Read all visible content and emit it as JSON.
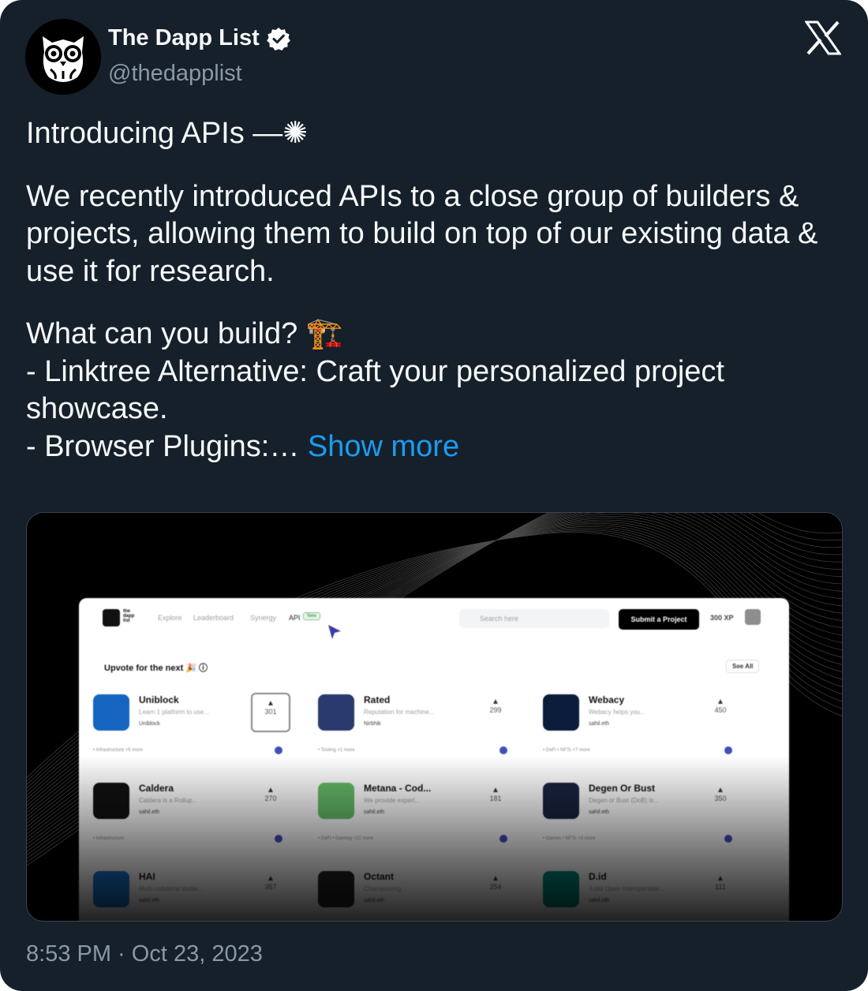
{
  "author": {
    "name": "The Dapp List",
    "handle": "@thedapplist",
    "verified": true,
    "avatar_icon": "owl-logo-icon"
  },
  "platform_icon": "x-logo-icon",
  "tweet": {
    "line1": "Introducing APIs —✺",
    "para2": "We recently introduced APIs to a close group of builders & projects, allowing them to build on top of our existing data & use it for research.",
    "para3_l1": "What can you build? 🏗️",
    "para3_l2": "- Linktree Alternative: Craft your personalized project showcase.",
    "para3_l3": "- Browser Plugins:…",
    "show_more": "Show more"
  },
  "media": {
    "nav": {
      "logo_text": "the dapp list",
      "links": [
        "Explore",
        "Leaderboard",
        "Synergy",
        "API"
      ],
      "new_badge": "New",
      "search_placeholder": "Search here",
      "submit_label": "Submit a Project",
      "xp": "300 XP"
    },
    "section_title": "Upvote for the next 🎉 ⓘ",
    "see_all": "See All",
    "projects": [
      {
        "name": "Uniblock",
        "desc": "Learn 1 platform to use...",
        "owner": "Uniblock",
        "votes": "301",
        "tags": "• Infrastructure +5 more",
        "color": "#1565c0"
      },
      {
        "name": "Rated",
        "desc": "Reputation for machine...",
        "owner": "Nirbhik",
        "votes": "299",
        "tags": "• Tooling +1 more",
        "color": "#2a3a6e"
      },
      {
        "name": "Webacy",
        "desc": "Webacy helps you...",
        "owner": "sahil.eth",
        "votes": "450",
        "tags": "• DeFi • NFTs +7 more",
        "color": "#0b1d3a"
      },
      {
        "name": "Caldera",
        "desc": "Caldera is a Rollup...",
        "owner": "sahil.eth",
        "votes": "270",
        "tags": "• Infrastructure",
        "color": "#111111"
      },
      {
        "name": "Metana - Cod...",
        "desc": "We provide expert...",
        "owner": "sahil.eth",
        "votes": "181",
        "tags": "• DeFi • Gaming +22 more",
        "color": "#66bb6a"
      },
      {
        "name": "Degen Or Bust",
        "desc": "Degen or Bust (DoB) is...",
        "owner": "sahil.eth",
        "votes": "350",
        "tags": "• Games • NFTs +3 more",
        "color": "#1a2440"
      },
      {
        "name": "HAI",
        "desc": "Multi-collateral stable...",
        "owner": "sahil.eth",
        "votes": "357",
        "tags": "",
        "color": "#1976d2"
      },
      {
        "name": "Octant",
        "desc": "Championing...",
        "owner": "sahil.eth",
        "votes": "254",
        "tags": "",
        "color": "#222222"
      },
      {
        "name": "D.id",
        "desc": "A dId Open Interoperable...",
        "owner": "sahil.eth",
        "votes": "111",
        "tags": "",
        "color": "#00897b"
      }
    ]
  },
  "timestamp": "8:53 PM · Oct 23, 2023"
}
